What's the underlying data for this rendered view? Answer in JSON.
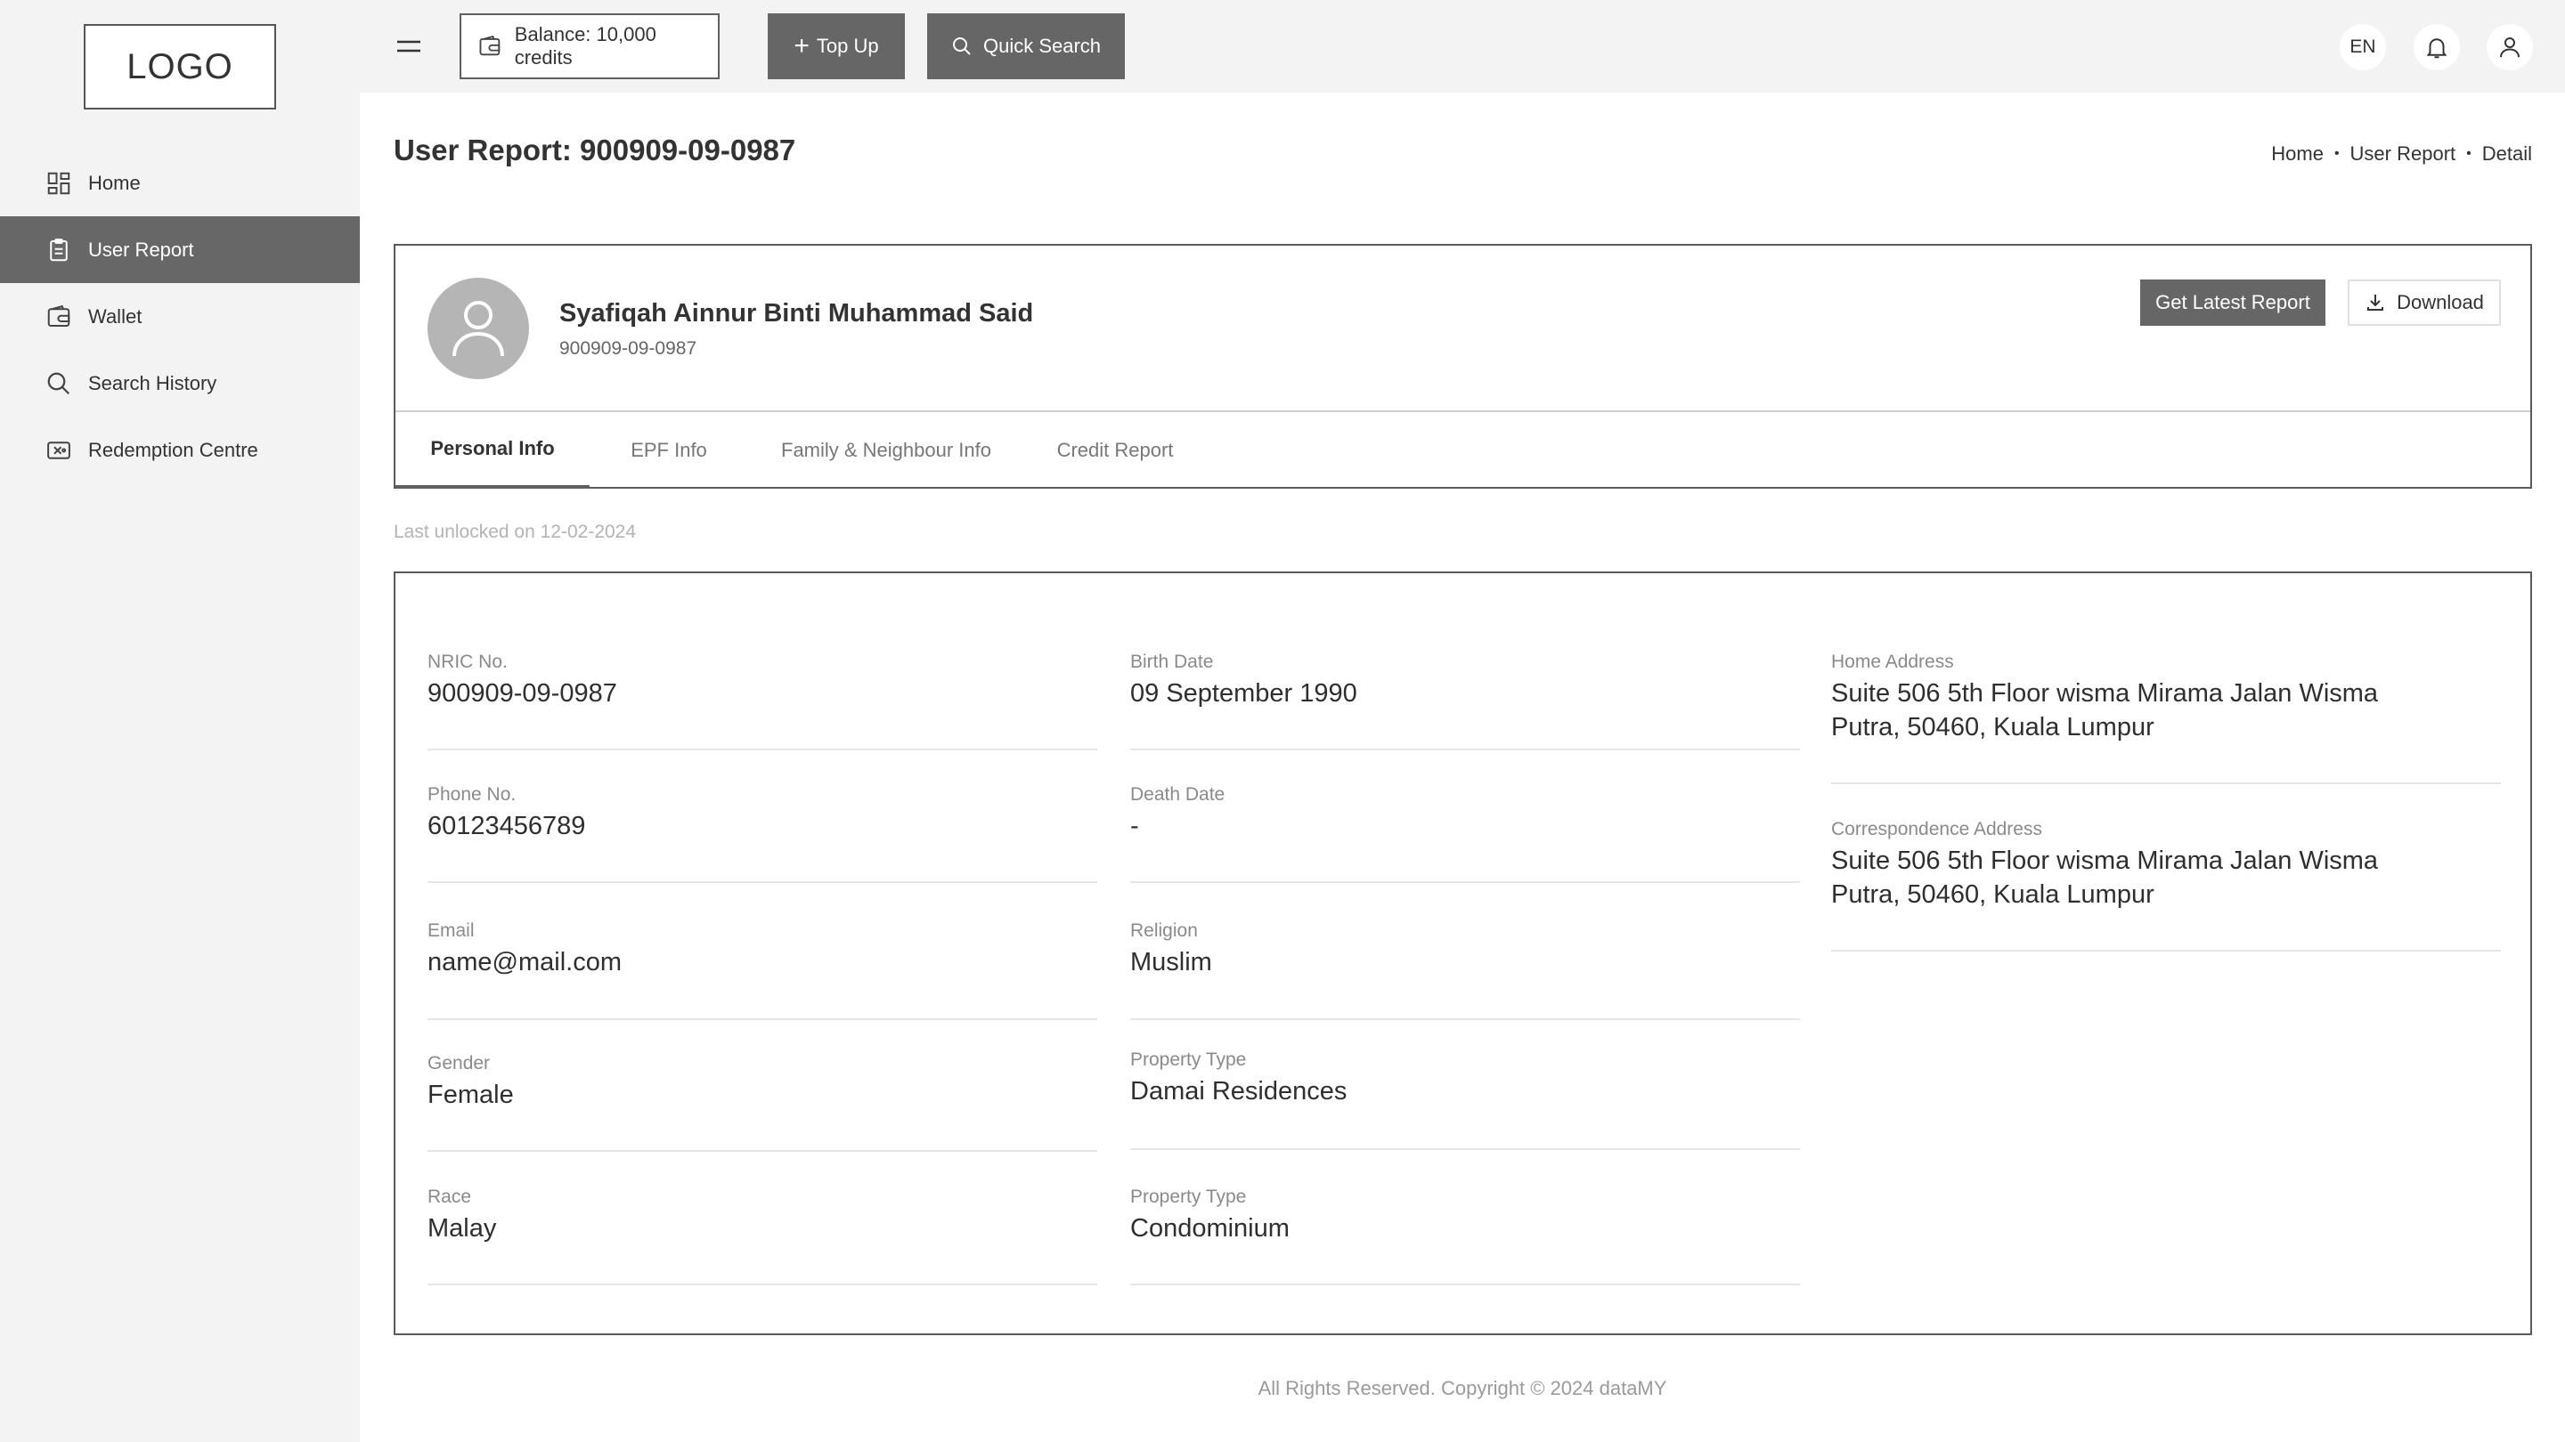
{
  "logo": "LOGO",
  "sidebar": {
    "items": [
      {
        "label": "Home",
        "icon": "dashboard-icon",
        "active": false
      },
      {
        "label": "User Report",
        "icon": "clipboard-icon",
        "active": true
      },
      {
        "label": "Wallet",
        "icon": "wallet-icon",
        "active": false
      },
      {
        "label": "Search History",
        "icon": "search-icon",
        "active": false
      },
      {
        "label": "Redemption Centre",
        "icon": "ticket-icon",
        "active": false
      }
    ]
  },
  "topbar": {
    "balance": "Balance: 10,000 credits",
    "topup": "Top Up",
    "quick_search": "Quick Search",
    "language": "EN"
  },
  "page": {
    "title": "User Report: 900909-09-0987",
    "breadcrumb": [
      "Home",
      "User Report",
      "Detail"
    ]
  },
  "profile": {
    "name": "Syafiqah Ainnur Binti Muhammad Said",
    "id": "900909-09-0987",
    "latest_report_label": "Get Latest Report",
    "download_label": "Download"
  },
  "tabs": [
    {
      "label": "Personal Info",
      "active": true
    },
    {
      "label": "EPF Info",
      "active": false
    },
    {
      "label": "Family & Neighbour Info",
      "active": false
    },
    {
      "label": "Credit Report",
      "active": false
    }
  ],
  "last_unlocked": "Last unlocked on 12-02-2024",
  "details": {
    "col1": [
      {
        "label": "NRIC No.",
        "value": "900909-09-0987"
      },
      {
        "label": "Phone No.",
        "value": "60123456789"
      },
      {
        "label": "Email",
        "value": "name@mail.com"
      },
      {
        "label": "Gender",
        "value": "Female"
      },
      {
        "label": "Race",
        "value": "Malay"
      }
    ],
    "col2": [
      {
        "label": "Birth Date",
        "value": "09 September 1990"
      },
      {
        "label": "Death Date",
        "value": "-"
      },
      {
        "label": "Religion",
        "value": "Muslim"
      },
      {
        "label": "Property Type",
        "value": "Damai Residences"
      },
      {
        "label": "Property Type",
        "value": "Condominium"
      }
    ],
    "col3": [
      {
        "label": "Home Address",
        "value": "Suite 506 5th Floor wisma Mirama Jalan Wisma Putra, 50460, Kuala Lumpur"
      },
      {
        "label": "Correspondence Address",
        "value": "Suite 506 5th Floor wisma Mirama Jalan Wisma Putra, 50460, Kuala Lumpur"
      }
    ]
  },
  "footer": "All Rights Reserved. Copyright © 2024 dataMY"
}
